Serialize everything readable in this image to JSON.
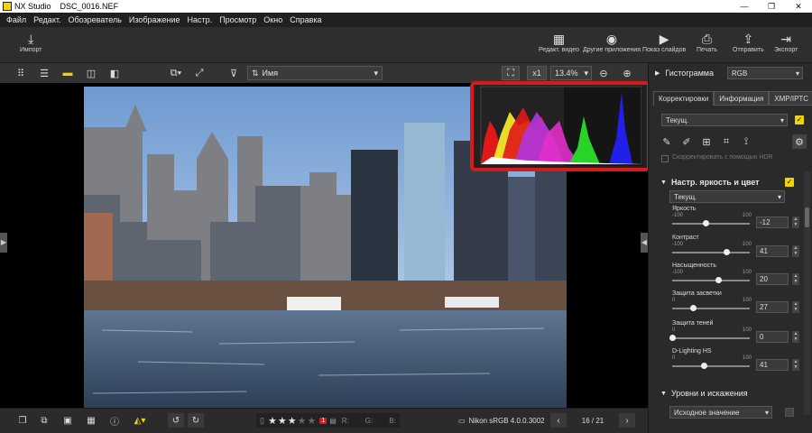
{
  "window": {
    "app": "NX Studio",
    "file": "DSC_0016.NEF"
  },
  "menu": [
    "Файл",
    "Редакт.",
    "Обозреватель",
    "Изображение",
    "Настр.",
    "Просмотр",
    "Окно",
    "Справка"
  ],
  "toolbar": {
    "import": "Импорт",
    "edit_video": "Редакт. видео",
    "other_apps": "Другие приложения",
    "slideshow": "Показ слайдов",
    "print": "Печать",
    "send": "Отправить",
    "export": "Экспорт"
  },
  "viewbar": {
    "sort": "Имя",
    "zoom_factor": "x1",
    "zoom": "13.4%"
  },
  "bottombar": {
    "stars": 3,
    "max_stars": 5,
    "label_r": "R:",
    "label_g": "G:",
    "label_b": "B:",
    "color_profile": "Nikon sRGB 4.0.0.3002",
    "page": "16 / 21",
    "flag": "1"
  },
  "panel": {
    "histogram_title": "Гистограмма",
    "histogram_channel": "RGB",
    "tabs": [
      "Корректировки",
      "Информация",
      "XMP/IPTC"
    ],
    "preset": "Текущ.",
    "hdr_label": "Скорректировать с помощью HDR",
    "section_brightness": "Настр. яркость и цвет",
    "section_preset": "Текущ.",
    "sliders": [
      {
        "name": "Яркость",
        "min": "-100",
        "max": "100",
        "value": "-12",
        "fraction": 0.44
      },
      {
        "name": "Контраст",
        "min": "-100",
        "max": "100",
        "value": "41",
        "fraction": 0.705
      },
      {
        "name": "Насыщенность",
        "min": "-100",
        "max": "100",
        "value": "20",
        "fraction": 0.6
      },
      {
        "name": "Защита засветки",
        "min": "0",
        "max": "100",
        "value": "27",
        "fraction": 0.27
      },
      {
        "name": "Защита теней",
        "min": "0",
        "max": "100",
        "value": "0",
        "fraction": 0.0
      },
      {
        "name": "D-Lighting HS",
        "min": "0",
        "max": "100",
        "value": "41",
        "fraction": 0.41
      }
    ],
    "section_levels": "Уровни и искажения",
    "levels_preset": "Исходное значение"
  },
  "colors": {
    "accent": "#f2d400",
    "highlight": "#d71a1a"
  }
}
